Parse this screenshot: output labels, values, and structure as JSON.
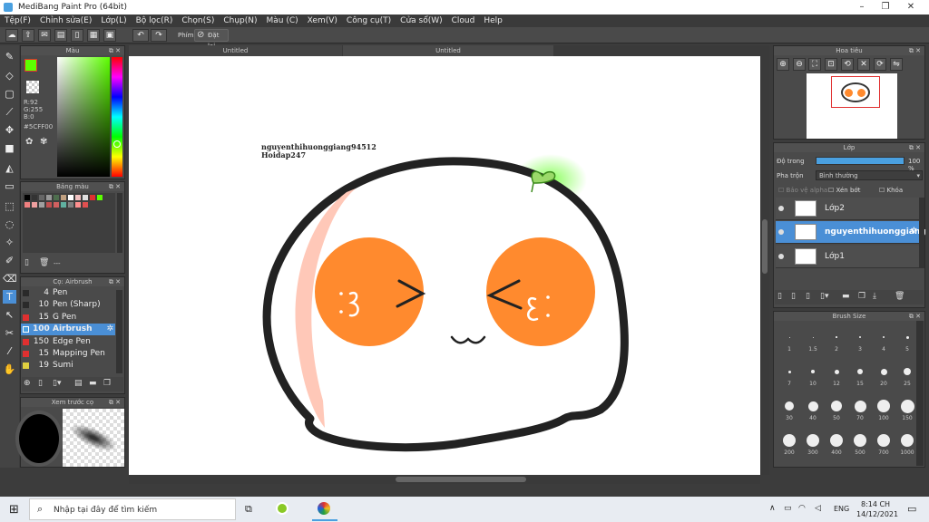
{
  "window": {
    "title": "MediBang Paint Pro (64bit)"
  },
  "menu": [
    "Tệp(F)",
    "Chỉnh sửa(E)",
    "Lớp(L)",
    "Bộ lọc(R)",
    "Chọn(S)",
    "Chụp(N)",
    "Màu (C)",
    "Xem(V)",
    "Công cụ(T)",
    "Cửa sổ(W)",
    "Cloud",
    "Help"
  ],
  "toolbar": {
    "phim_label": "Phím",
    "reset_label": "Đặt lại"
  },
  "tabs": {
    "tab1": "Untitled",
    "tab2": "Untitled"
  },
  "color_panel": {
    "title": "Màu",
    "r": "R:92",
    "g": "G:255",
    "b": "B:0",
    "hex": "#5CFF00"
  },
  "palette_panel": {
    "title": "Bảng màu",
    "footer": "---"
  },
  "brush_panel": {
    "title": "Cọ: Airbrush",
    "items": [
      {
        "size": "4",
        "name": "Pen",
        "color": "#2a2a2a"
      },
      {
        "size": "10",
        "name": "Pen (Sharp)",
        "color": "#2a2a2a"
      },
      {
        "size": "15",
        "name": "G Pen",
        "color": "#e03030"
      },
      {
        "size": "100",
        "name": "Airbrush",
        "color": "#4aa0e0"
      },
      {
        "size": "150",
        "name": "Edge Pen",
        "color": "#e03030"
      },
      {
        "size": "15",
        "name": "Mapping Pen",
        "color": "#e03030"
      },
      {
        "size": "19",
        "name": "Sumi",
        "color": "#e0d040"
      }
    ]
  },
  "preview_panel": {
    "title": "Xem trước cọ"
  },
  "navigator": {
    "title": "Hoa tiêu"
  },
  "layer_panel": {
    "title": "Lớp",
    "opacity_label": "Độ trong",
    "opacity_value": "100 %",
    "blend_label": "Pha trộn",
    "blend_value": "Bình thường",
    "protect_alpha": "Bảo vệ alpha",
    "clip": "Xén bớt",
    "lock": "Khóa",
    "layers": [
      {
        "name": "Lớp2",
        "selected": false
      },
      {
        "name": "nguyenthihuonggiang",
        "selected": true
      },
      {
        "name": "Lớp1",
        "selected": false
      }
    ]
  },
  "brush_size": {
    "title": "Brush Size",
    "sizes": [
      "1",
      "1.5",
      "2",
      "3",
      "4",
      "5",
      "7",
      "10",
      "12",
      "15",
      "20",
      "25",
      "30",
      "40",
      "50",
      "70",
      "100",
      "150",
      "200",
      "300",
      "400",
      "500",
      "700",
      "1000"
    ]
  },
  "canvas": {
    "text_line1": "nguyenthihuonggiang94512",
    "text_line2": "Hoidap247"
  },
  "taskbar": {
    "search_placeholder": "Nhập tại đây để tìm kiếm",
    "lang": "ENG",
    "time": "8:14 CH",
    "date": "14/12/2021"
  }
}
